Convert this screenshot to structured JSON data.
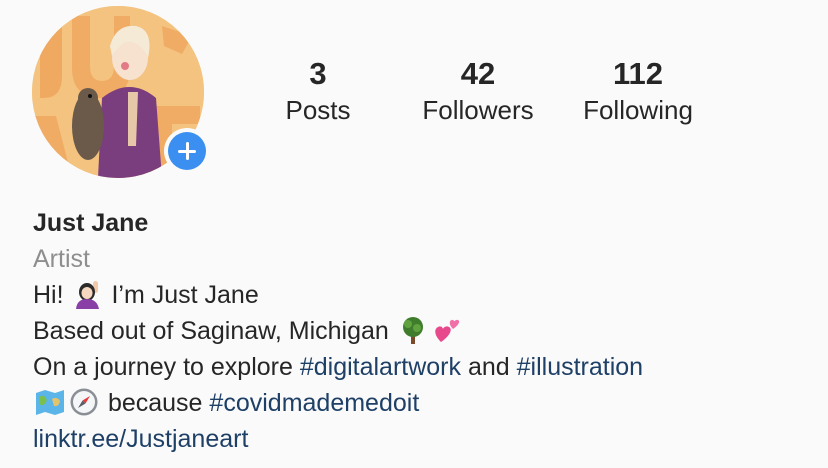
{
  "profile": {
    "stats": [
      {
        "value": "3",
        "label": "Posts"
      },
      {
        "value": "42",
        "label": "Followers"
      },
      {
        "value": "112",
        "label": "Following"
      }
    ],
    "name": "Just Jane",
    "category": "Artist",
    "bio": {
      "line1_a": "Hi! ",
      "line1_b": " I’m Just Jane",
      "line2": "Based out of Saginaw, Michigan ",
      "line3_a": "On a journey to explore ",
      "line3_tag1": "#digitalartwork",
      "line3_mid": " and ",
      "line3_tag2": "#illustration",
      "line4_a": " because ",
      "line4_tag": "#covidmademedoit",
      "link": "linktr.ee/Justjaneart"
    },
    "emojis": [
      "raising-hand-emoji",
      "tree-emoji",
      "two-hearts-emoji",
      "map-emoji",
      "compass-emoji"
    ],
    "accent_color": "#3b8ff0",
    "link_color": "#1e3f66"
  }
}
